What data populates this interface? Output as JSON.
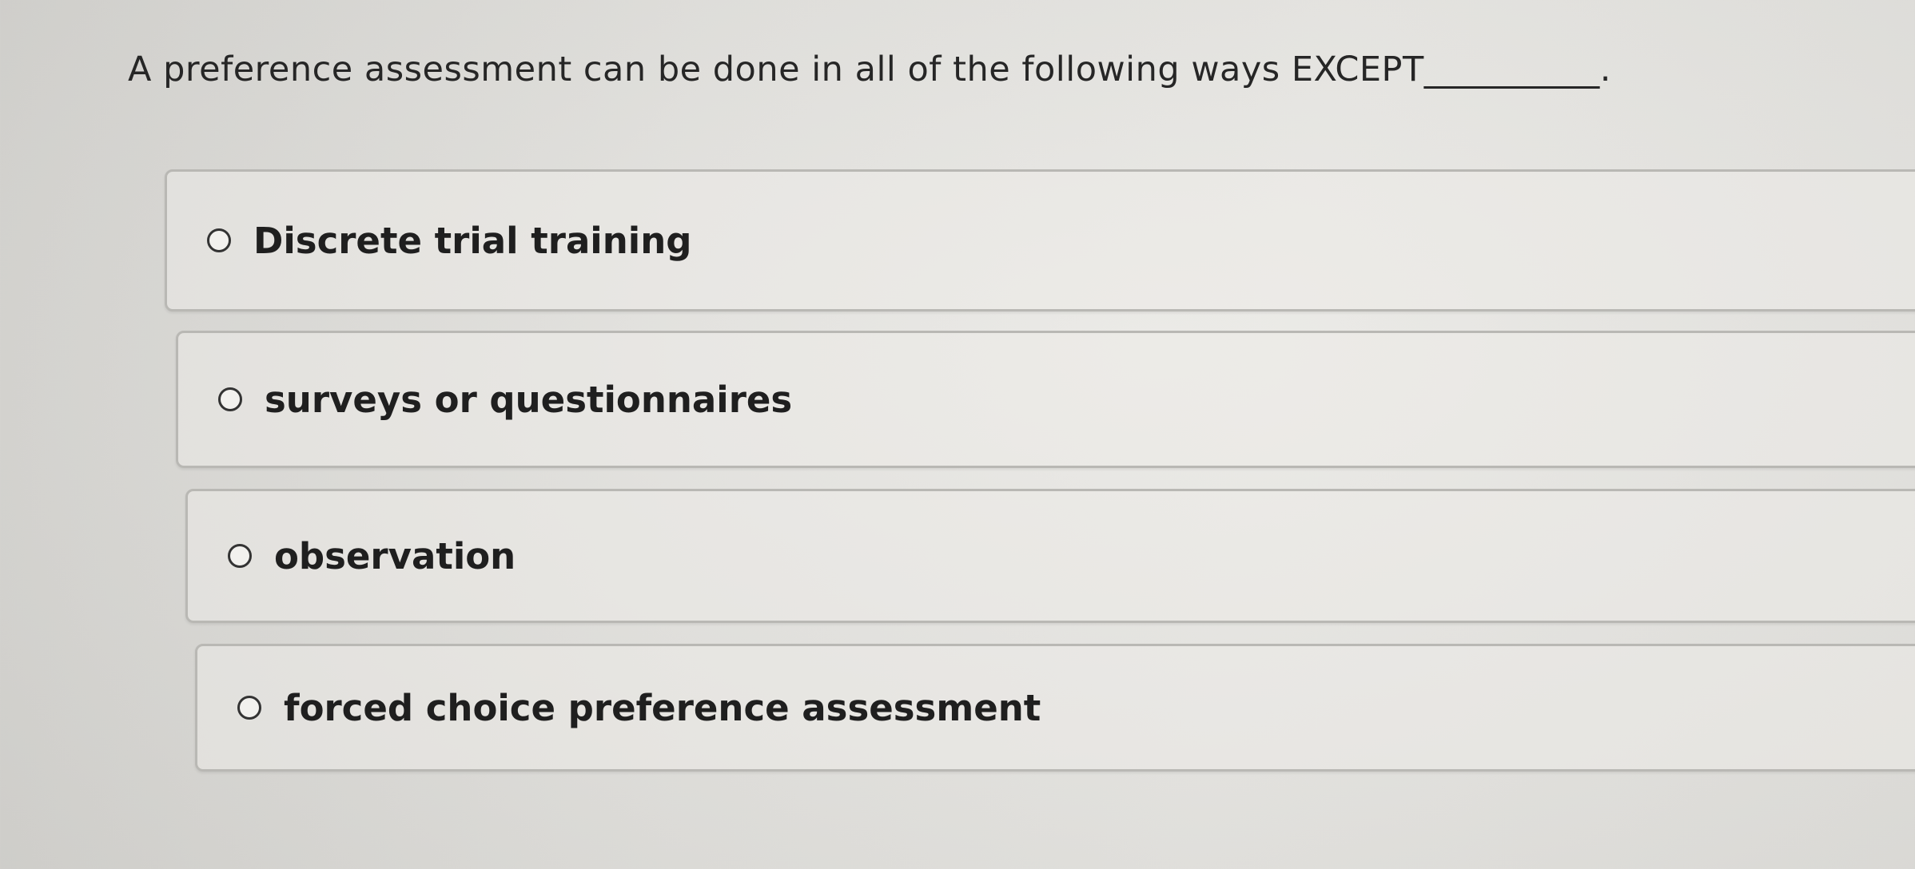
{
  "question": {
    "text": "A preference assessment can be done in all of the following ways EXCEPT__________."
  },
  "options": [
    {
      "label": "Discrete trial training",
      "selected": false
    },
    {
      "label": "surveys or questionnaires",
      "selected": false
    },
    {
      "label": "observation",
      "selected": false
    },
    {
      "label": "forced choice preference assessment",
      "selected": false
    }
  ],
  "colors": {
    "background": "#e3e2de",
    "card_border": "#b9b8b4",
    "text": "#222222"
  }
}
